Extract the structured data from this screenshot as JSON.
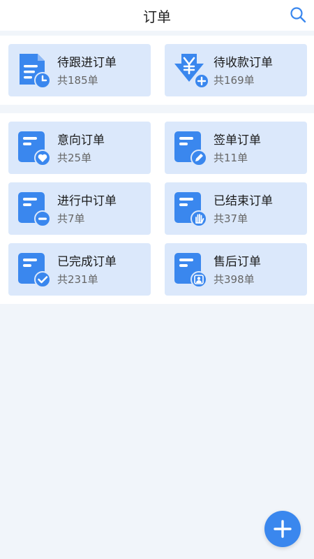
{
  "header": {
    "title": "订单",
    "search_icon": "search-icon"
  },
  "summary": [
    {
      "title": "待跟进订单",
      "count": "共185单",
      "icon": "document-clock-icon"
    },
    {
      "title": "待收款订单",
      "count": "共169单",
      "icon": "yuan-receive-icon"
    }
  ],
  "orders": [
    {
      "title": "意向订单",
      "count": "共25单",
      "icon": "heart-badge-icon"
    },
    {
      "title": "签单订单",
      "count": "共11单",
      "icon": "pen-badge-icon"
    },
    {
      "title": "进行中订单",
      "count": "共7单",
      "icon": "minus-badge-icon"
    },
    {
      "title": "已结束订单",
      "count": "共37单",
      "icon": "hand-badge-icon"
    },
    {
      "title": "已完成订单",
      "count": "共231单",
      "icon": "check-badge-icon"
    },
    {
      "title": "售后订单",
      "count": "共398单",
      "icon": "person-badge-icon"
    }
  ],
  "colors": {
    "accent": "#3a87ee",
    "card_bg": "#dbe8fb",
    "page_bg": "#f1f5fa"
  },
  "fab": {
    "icon": "plus-icon"
  }
}
